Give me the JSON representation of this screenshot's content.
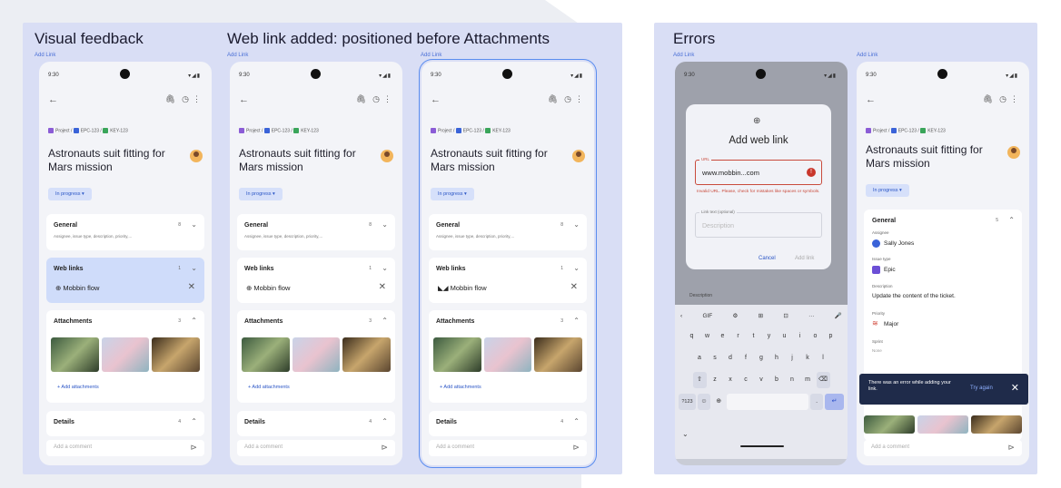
{
  "sections": {
    "visual_feedback_title": "Visual feedback",
    "web_link_title": "Web link added: positioned before Attachments",
    "errors_title": "Errors",
    "add_link_label": "Add Link"
  },
  "phone": {
    "time": "9:30",
    "signal": "▾◢▮",
    "back_glyph": "←",
    "clip_glyph": "🖇",
    "history_glyph": "◷",
    "more_glyph": "⋮",
    "crumb_project": "Project",
    "crumb_sep": "/",
    "crumb_epic": "EPC-123",
    "crumb_key": "KEY-123",
    "title": "Astronauts suit fitting for Mars mission",
    "status": "In progress",
    "status_caret": "▾",
    "general_title": "General",
    "general_count": "8",
    "general_sub": "Assignee, issue type, description, priority,...",
    "weblinks_title": "Web links",
    "weblinks_count": "1",
    "weblink_text": "Mobbin flow",
    "globe_glyph": "⊕",
    "mobbin_glyph": "◣◢",
    "close_glyph": "✕",
    "chevron_down": "⌄",
    "chevron_up": "⌃",
    "attachments_title": "Attachments",
    "attachments_count": "3",
    "add_attachments": "+ Add attachments",
    "details_title": "Details",
    "details_count": "4",
    "comment_placeholder": "Add a comment",
    "send_glyph": "⊳"
  },
  "error_dialog": {
    "title": "Add web link",
    "url_label": "URL",
    "url_value": "www.mobbin...com",
    "err_icon": "!",
    "error_text": "Invalid URL. Please, check for mistakes like spaces or symbols.",
    "link_text_label": "Link text (optional)",
    "link_text_placeholder": "Description",
    "cancel": "Cancel",
    "add_link": "Add link",
    "description_label": "Description"
  },
  "keyboard": {
    "tools": [
      "‹",
      "GIF",
      "⚙",
      "⊞",
      "⊡",
      "···",
      "🎤"
    ],
    "row1": [
      "q",
      "w",
      "e",
      "r",
      "t",
      "y",
      "u",
      "i",
      "o",
      "p"
    ],
    "row2": [
      "a",
      "s",
      "d",
      "f",
      "g",
      "h",
      "j",
      "k",
      "l"
    ],
    "row3": [
      "⇧",
      "z",
      "x",
      "c",
      "v",
      "b",
      "n",
      "m",
      "⌫"
    ],
    "sym": "?123",
    "emoji": "☺",
    "globe": "⊕",
    "dot": ".",
    "enter": "↵",
    "nav_down": "⌄"
  },
  "error_phone2": {
    "assignee_label": "Assignee",
    "assignee_value": "Sally Jones",
    "issue_type_label": "Issue type",
    "issue_type_value": "Epic",
    "description_label": "Description",
    "description_value": "Update the content of the ticket.",
    "priority_label": "Priority",
    "priority_value": "Major",
    "sprint_label": "Sprint",
    "sprint_value": "None",
    "snackbar_message": "There was an error while adding your link.",
    "try_again": "Try again",
    "general_count": "5"
  },
  "colors": {
    "accent": "#2b56c6",
    "panel": "#d9def5",
    "error": "#c94b3c",
    "snackbar": "#1f2b4a"
  }
}
